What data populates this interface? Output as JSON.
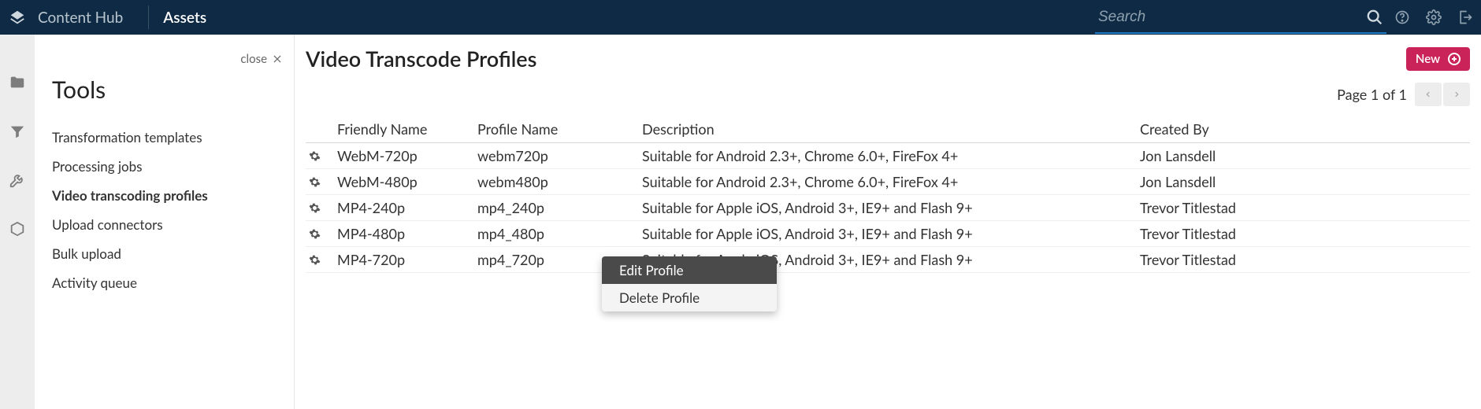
{
  "header": {
    "app_name": "Content Hub",
    "section": "Assets",
    "search_placeholder": "Search"
  },
  "tools": {
    "close_label": "close",
    "title": "Tools",
    "items": [
      {
        "label": "Transformation templates",
        "active": false
      },
      {
        "label": "Processing jobs",
        "active": false
      },
      {
        "label": "Video transcoding profiles",
        "active": true
      },
      {
        "label": "Upload connectors",
        "active": false
      },
      {
        "label": "Bulk upload",
        "active": false
      },
      {
        "label": "Activity queue",
        "active": false
      }
    ]
  },
  "page": {
    "title": "Video Transcode Profiles",
    "new_label": "New",
    "page_info": "Page 1 of 1"
  },
  "table": {
    "columns": {
      "friendly": "Friendly Name",
      "profile": "Profile Name",
      "desc": "Description",
      "created": "Created By"
    },
    "rows": [
      {
        "friendly": "WebM-720p",
        "profile": "webm720p",
        "desc": "Suitable for Android 2.3+, Chrome 6.0+, FireFox 4+",
        "created": "Jon Lansdell"
      },
      {
        "friendly": "WebM-480p",
        "profile": "webm480p",
        "desc": "Suitable for Android 2.3+, Chrome 6.0+, FireFox 4+",
        "created": "Jon Lansdell"
      },
      {
        "friendly": "MP4-240p",
        "profile": "mp4_240p",
        "desc": "Suitable for Apple iOS, Android 3+, IE9+ and Flash 9+",
        "created": "Trevor Titlestad"
      },
      {
        "friendly": "MP4-480p",
        "profile": "mp4_480p",
        "desc": "Suitable for Apple iOS, Android 3+, IE9+ and Flash 9+",
        "created": "Trevor Titlestad"
      },
      {
        "friendly": "MP4-720p",
        "profile": "mp4_720p",
        "desc": "Suitable for Apple iOS, Android 3+, IE9+ and Flash 9+",
        "created": "Trevor Titlestad"
      }
    ]
  },
  "context_menu": {
    "items": [
      {
        "label": "Edit Profile",
        "highlight": true
      },
      {
        "label": "Delete Profile",
        "highlight": false
      }
    ]
  }
}
